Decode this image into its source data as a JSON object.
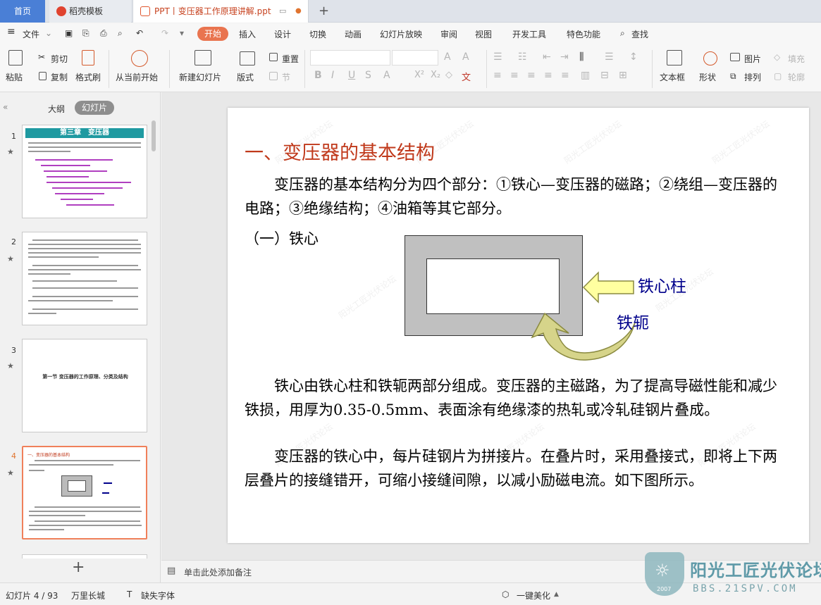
{
  "tabs": {
    "home": "首页",
    "template": "稻壳模板",
    "document": "PPT丨变压器工作原理讲解.ppt",
    "new_tab": "+"
  },
  "menu": {
    "file": "文件",
    "items": [
      "开始",
      "插入",
      "设计",
      "切换",
      "动画",
      "幻灯片放映",
      "审阅",
      "视图",
      "开发工具",
      "特色功能"
    ],
    "search": "查找"
  },
  "ribbon": {
    "paste": "粘贴",
    "cut": "剪切",
    "copy": "复制",
    "format_painter": "格式刷",
    "from_current": "从当前开始",
    "new_slide": "新建幻灯片",
    "layout": "版式",
    "reset": "重置",
    "section": "节",
    "text_box": "文本框",
    "shape": "形状",
    "picture": "图片",
    "arrange": "排列",
    "fill": "填充",
    "outline": "轮廓"
  },
  "left_panel": {
    "outline_tab": "大纲",
    "slides_tab": "幻灯片",
    "add_slide": "+",
    "thumbs": [
      {
        "num": "1",
        "title": "第三章　变压器"
      },
      {
        "num": "2"
      },
      {
        "num": "3",
        "title": "第一节 变压器的工作原理、分类及结构"
      },
      {
        "num": "4",
        "title": "一、变压器的基本结构"
      }
    ]
  },
  "slide": {
    "heading": "一、变压器的基本结构",
    "para1": "　　变压器的基本结构分为四个部分：①铁心—变压器的磁路；②绕组—变压器的电路；③绝缘结构；④油箱等其它部分。",
    "subheading": "（一）铁心",
    "label_core_column": "铁心柱",
    "label_yoke": "铁轭",
    "para2": "　　铁心由铁心柱和铁轭两部分组成。变压器的主磁路，为了提高导磁性能和减少铁损，用厚为0.35-0.5mm、表面涂有绝缘漆的热轧或冷轧硅钢片叠成。",
    "para3": "　　变压器的铁心中，每片硅钢片为拼接片。在叠片时，采用叠接式，即将上下两层叠片的接缝错开，可缩小接缝间隙，以减小励磁电流。如下图所示。",
    "heading_color": "#c0391b",
    "label_color": "#00008b"
  },
  "notes": {
    "placeholder": "单击此处添加备注"
  },
  "status": {
    "slide_count": "幻灯片 4 / 93",
    "theme": "万里长城",
    "missing_fonts": "缺失字体",
    "beautify": "一键美化"
  },
  "watermark": {
    "brand": "阳光工匠光伏论坛",
    "url": "BBS.21SPV.COM",
    "year": "2007"
  }
}
